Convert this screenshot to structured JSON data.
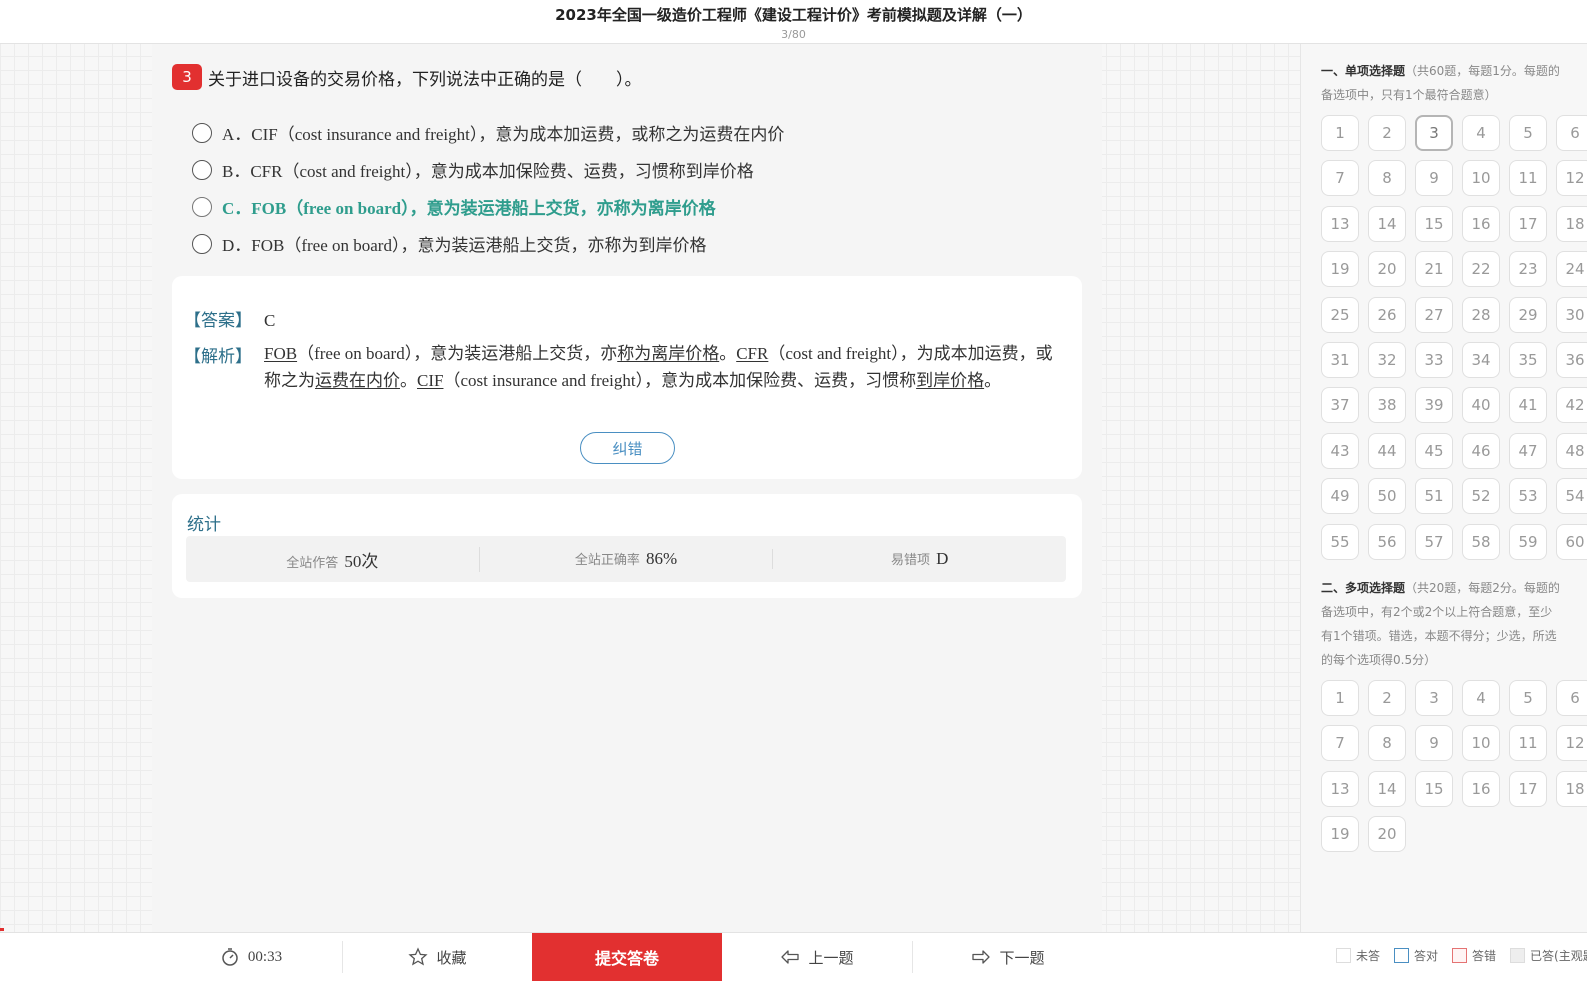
{
  "header": {
    "title": "2023年全国一级造价工程师《建设工程计价》考前模拟题及详解（一）",
    "progress": "3/80"
  },
  "question": {
    "number": "3",
    "text": "关于进口设备的交易价格，下列说法中正确的是（　　）。",
    "options": [
      {
        "label": "A．CIF（cost insurance and freight），意为成本加运费，或称之为运费在内价",
        "correct": false
      },
      {
        "label": "B．CFR（cost and freight），意为成本加保险费、运费，习惯称到岸价格",
        "correct": false
      },
      {
        "label": "C．FOB（free on board），意为装运港船上交货，亦称为离岸价格",
        "correct": true
      },
      {
        "label": "D．FOB（free on board），意为装运港船上交货，亦称为到岸价格",
        "correct": false
      }
    ]
  },
  "explanation": {
    "answer_label": "【答案】",
    "answer_value": "C",
    "analysis_label": "【解析】",
    "analysis_parts": [
      {
        "t": "FOB",
        "u": true
      },
      {
        "t": "（free on board），意为装运港船上交货，亦",
        "u": false
      },
      {
        "t": "称为离岸价格",
        "u": true
      },
      {
        "t": "。",
        "u": false
      },
      {
        "t": "CFR",
        "u": true
      },
      {
        "t": "（cost and freight），为成本加运费，或称之为",
        "u": false
      },
      {
        "t": "运费在内价",
        "u": true
      },
      {
        "t": "。",
        "u": false
      },
      {
        "t": "CIF",
        "u": true
      },
      {
        "t": "（cost insurance and freight），意为成本加保险费、运费，习惯称",
        "u": false
      },
      {
        "t": "到岸价格",
        "u": true
      },
      {
        "t": "。",
        "u": false
      }
    ],
    "report_button": "纠错"
  },
  "stats": {
    "title": "统计",
    "items": [
      {
        "label": "全站作答",
        "value": "50次"
      },
      {
        "label": "全站正确率",
        "value": "86%"
      },
      {
        "label": "易错项",
        "value": "D"
      }
    ]
  },
  "sidebar": {
    "section1": {
      "bold": "一、单项选择题",
      "line1": "（共60题，每题1分。每题的",
      "line2": "备选项中，只有1个最符合题意）",
      "count": 60,
      "current": 3
    },
    "section2": {
      "bold": "二、多项选择题",
      "line1": "（共20题，每题2分。每题的",
      "line2": "备选项中，有2个或2个以上符合题意，至少",
      "line3": "有1个错项。错选，本题不得分；少选，所选",
      "line4": "的每个选项得0.5分）",
      "count": 20
    }
  },
  "bottombar": {
    "timer": "00:33",
    "favorite": "收藏",
    "submit": "提交答卷",
    "prev": "上一题",
    "next": "下一题"
  },
  "legend": {
    "unanswered": "未答",
    "right": "答对",
    "wrong": "答错",
    "subjective": "已答(主观题)"
  }
}
